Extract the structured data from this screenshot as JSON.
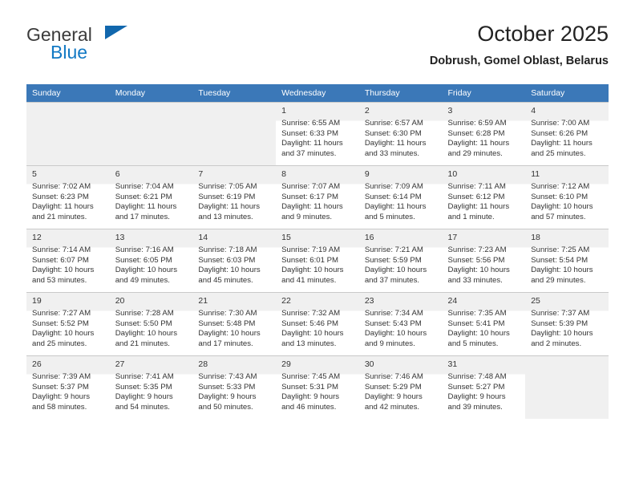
{
  "brand": {
    "name_top": "General",
    "name_bottom": "Blue",
    "accent_color": "#1279c4",
    "triangle_color": "#1167ad"
  },
  "header": {
    "title": "October 2025",
    "location": "Dobrush, Gomel Oblast, Belarus"
  },
  "calendar": {
    "header_color": "#3b78b8",
    "weekday_headers": [
      "Sunday",
      "Monday",
      "Tuesday",
      "Wednesday",
      "Thursday",
      "Friday",
      "Saturday"
    ],
    "weeks": [
      [
        {
          "day": "",
          "lines": []
        },
        {
          "day": "",
          "lines": []
        },
        {
          "day": "",
          "lines": []
        },
        {
          "day": "1",
          "lines": [
            "Sunrise: 6:55 AM",
            "Sunset: 6:33 PM",
            "Daylight: 11 hours",
            "and 37 minutes."
          ]
        },
        {
          "day": "2",
          "lines": [
            "Sunrise: 6:57 AM",
            "Sunset: 6:30 PM",
            "Daylight: 11 hours",
            "and 33 minutes."
          ]
        },
        {
          "day": "3",
          "lines": [
            "Sunrise: 6:59 AM",
            "Sunset: 6:28 PM",
            "Daylight: 11 hours",
            "and 29 minutes."
          ]
        },
        {
          "day": "4",
          "lines": [
            "Sunrise: 7:00 AM",
            "Sunset: 6:26 PM",
            "Daylight: 11 hours",
            "and 25 minutes."
          ]
        }
      ],
      [
        {
          "day": "5",
          "lines": [
            "Sunrise: 7:02 AM",
            "Sunset: 6:23 PM",
            "Daylight: 11 hours",
            "and 21 minutes."
          ]
        },
        {
          "day": "6",
          "lines": [
            "Sunrise: 7:04 AM",
            "Sunset: 6:21 PM",
            "Daylight: 11 hours",
            "and 17 minutes."
          ]
        },
        {
          "day": "7",
          "lines": [
            "Sunrise: 7:05 AM",
            "Sunset: 6:19 PM",
            "Daylight: 11 hours",
            "and 13 minutes."
          ]
        },
        {
          "day": "8",
          "lines": [
            "Sunrise: 7:07 AM",
            "Sunset: 6:17 PM",
            "Daylight: 11 hours",
            "and 9 minutes."
          ]
        },
        {
          "day": "9",
          "lines": [
            "Sunrise: 7:09 AM",
            "Sunset: 6:14 PM",
            "Daylight: 11 hours",
            "and 5 minutes."
          ]
        },
        {
          "day": "10",
          "lines": [
            "Sunrise: 7:11 AM",
            "Sunset: 6:12 PM",
            "Daylight: 11 hours",
            "and 1 minute."
          ]
        },
        {
          "day": "11",
          "lines": [
            "Sunrise: 7:12 AM",
            "Sunset: 6:10 PM",
            "Daylight: 10 hours",
            "and 57 minutes."
          ]
        }
      ],
      [
        {
          "day": "12",
          "lines": [
            "Sunrise: 7:14 AM",
            "Sunset: 6:07 PM",
            "Daylight: 10 hours",
            "and 53 minutes."
          ]
        },
        {
          "day": "13",
          "lines": [
            "Sunrise: 7:16 AM",
            "Sunset: 6:05 PM",
            "Daylight: 10 hours",
            "and 49 minutes."
          ]
        },
        {
          "day": "14",
          "lines": [
            "Sunrise: 7:18 AM",
            "Sunset: 6:03 PM",
            "Daylight: 10 hours",
            "and 45 minutes."
          ]
        },
        {
          "day": "15",
          "lines": [
            "Sunrise: 7:19 AM",
            "Sunset: 6:01 PM",
            "Daylight: 10 hours",
            "and 41 minutes."
          ]
        },
        {
          "day": "16",
          "lines": [
            "Sunrise: 7:21 AM",
            "Sunset: 5:59 PM",
            "Daylight: 10 hours",
            "and 37 minutes."
          ]
        },
        {
          "day": "17",
          "lines": [
            "Sunrise: 7:23 AM",
            "Sunset: 5:56 PM",
            "Daylight: 10 hours",
            "and 33 minutes."
          ]
        },
        {
          "day": "18",
          "lines": [
            "Sunrise: 7:25 AM",
            "Sunset: 5:54 PM",
            "Daylight: 10 hours",
            "and 29 minutes."
          ]
        }
      ],
      [
        {
          "day": "19",
          "lines": [
            "Sunrise: 7:27 AM",
            "Sunset: 5:52 PM",
            "Daylight: 10 hours",
            "and 25 minutes."
          ]
        },
        {
          "day": "20",
          "lines": [
            "Sunrise: 7:28 AM",
            "Sunset: 5:50 PM",
            "Daylight: 10 hours",
            "and 21 minutes."
          ]
        },
        {
          "day": "21",
          "lines": [
            "Sunrise: 7:30 AM",
            "Sunset: 5:48 PM",
            "Daylight: 10 hours",
            "and 17 minutes."
          ]
        },
        {
          "day": "22",
          "lines": [
            "Sunrise: 7:32 AM",
            "Sunset: 5:46 PM",
            "Daylight: 10 hours",
            "and 13 minutes."
          ]
        },
        {
          "day": "23",
          "lines": [
            "Sunrise: 7:34 AM",
            "Sunset: 5:43 PM",
            "Daylight: 10 hours",
            "and 9 minutes."
          ]
        },
        {
          "day": "24",
          "lines": [
            "Sunrise: 7:35 AM",
            "Sunset: 5:41 PM",
            "Daylight: 10 hours",
            "and 5 minutes."
          ]
        },
        {
          "day": "25",
          "lines": [
            "Sunrise: 7:37 AM",
            "Sunset: 5:39 PM",
            "Daylight: 10 hours",
            "and 2 minutes."
          ]
        }
      ],
      [
        {
          "day": "26",
          "lines": [
            "Sunrise: 7:39 AM",
            "Sunset: 5:37 PM",
            "Daylight: 9 hours",
            "and 58 minutes."
          ]
        },
        {
          "day": "27",
          "lines": [
            "Sunrise: 7:41 AM",
            "Sunset: 5:35 PM",
            "Daylight: 9 hours",
            "and 54 minutes."
          ]
        },
        {
          "day": "28",
          "lines": [
            "Sunrise: 7:43 AM",
            "Sunset: 5:33 PM",
            "Daylight: 9 hours",
            "and 50 minutes."
          ]
        },
        {
          "day": "29",
          "lines": [
            "Sunrise: 7:45 AM",
            "Sunset: 5:31 PM",
            "Daylight: 9 hours",
            "and 46 minutes."
          ]
        },
        {
          "day": "30",
          "lines": [
            "Sunrise: 7:46 AM",
            "Sunset: 5:29 PM",
            "Daylight: 9 hours",
            "and 42 minutes."
          ]
        },
        {
          "day": "31",
          "lines": [
            "Sunrise: 7:48 AM",
            "Sunset: 5:27 PM",
            "Daylight: 9 hours",
            "and 39 minutes."
          ]
        },
        {
          "day": "",
          "lines": []
        }
      ]
    ]
  }
}
